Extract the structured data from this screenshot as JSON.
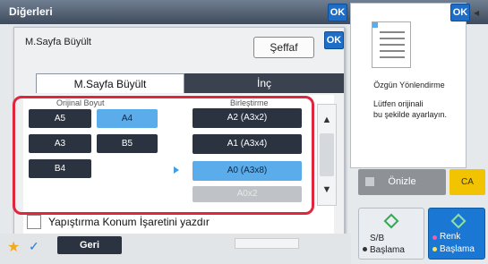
{
  "header": {
    "title": "Diğerleri",
    "ok1": "OK",
    "ok2": "OK"
  },
  "dialog": {
    "title": "M.Sayfa Büyült",
    "transparent_button": "Şeffaf",
    "ok": "OK",
    "tabs": [
      "M.Sayfa Büyült",
      "İnç"
    ],
    "original_header": "Orijinal Boyut",
    "target_header": "Birleştirme",
    "original_sizes": [
      "A5",
      "A4",
      "A3",
      "B5",
      "B4"
    ],
    "selected_original": "A4",
    "target_sizes": [
      "A2 (A3x2)",
      "A1 (A3x4)",
      "A0 (A3x8)",
      "A0x2"
    ],
    "selected_target": "A0 (A3x8)",
    "checkbox_label": "Yapıştırma Konum İşaretini yazdır"
  },
  "preview": {
    "title": "Özgün Yönlendirme",
    "message_line1": "Lütfen orijinali",
    "message_line2": "bu şekilde ayarlayın.",
    "ok": "OK"
  },
  "footer": {
    "back_label": "Geri",
    "preview_label": "Önizle",
    "ca_label": "CA",
    "bw_label_top": "S/B",
    "bw_label_bottom": "Başlama",
    "color_label_top": "Renk",
    "color_label_bottom": "Başlama"
  },
  "colors": {
    "accent": "#1e6ec8",
    "highlight": "#e0263c",
    "selected": "#5aacea",
    "ca": "#f2c300"
  }
}
